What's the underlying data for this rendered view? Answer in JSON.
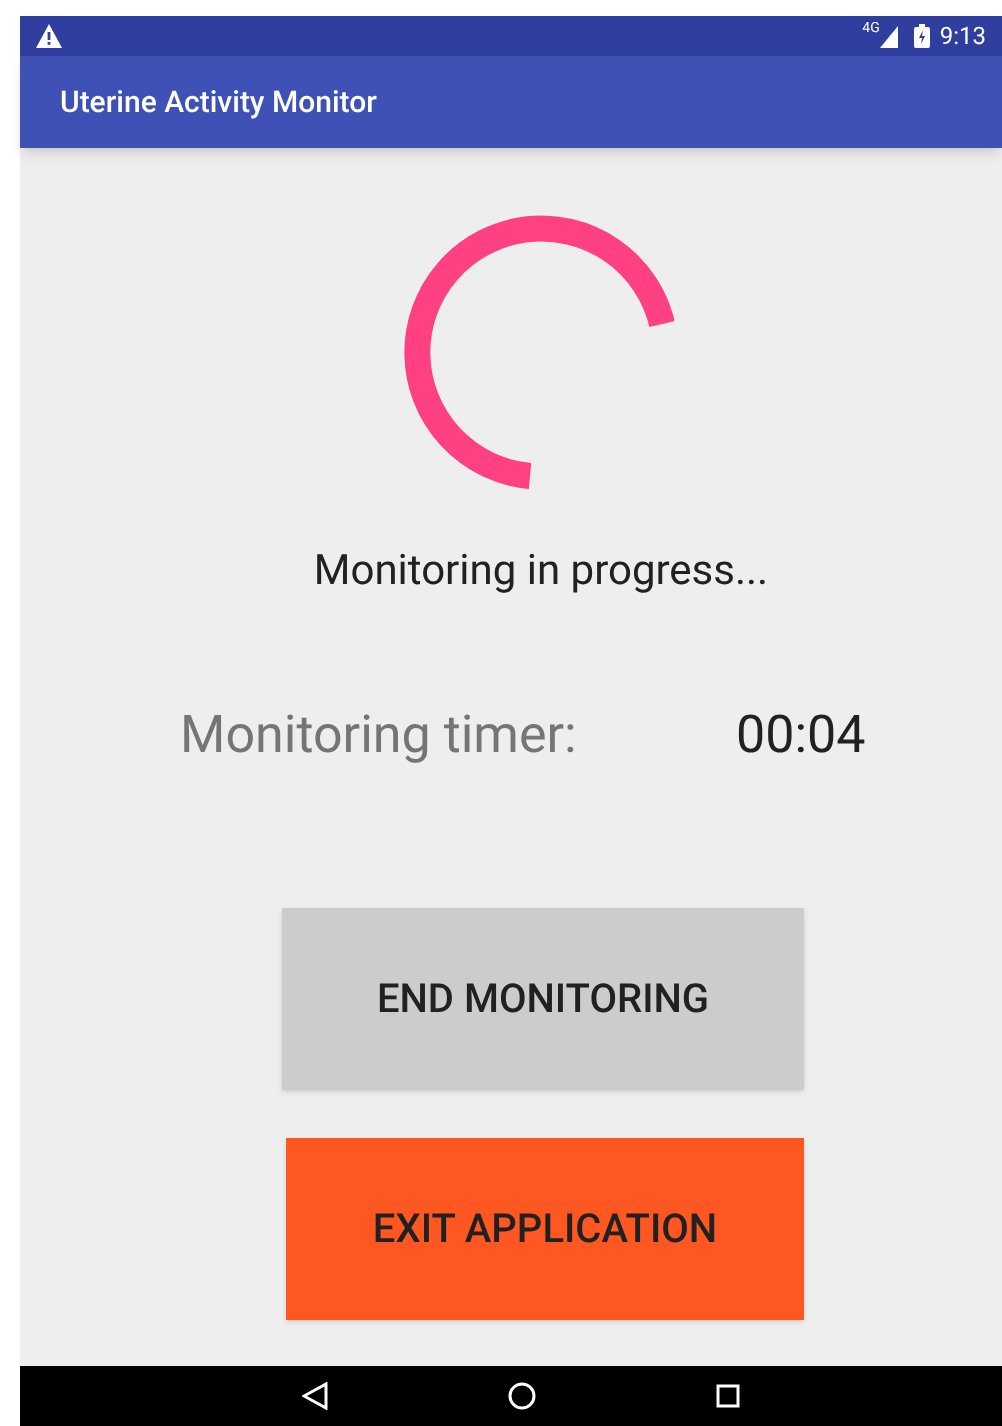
{
  "status_bar": {
    "time": "9:13",
    "network": "4G"
  },
  "app_bar": {
    "title": "Uterine Activity Monitor"
  },
  "status_text": "Monitoring in progress...",
  "timer": {
    "label": "Monitoring timer:",
    "value": "00:04"
  },
  "buttons": [
    {
      "label": "END MONITORING",
      "kind": "neutral"
    },
    {
      "label": "EXIT APPLICATION",
      "kind": "danger"
    }
  ]
}
